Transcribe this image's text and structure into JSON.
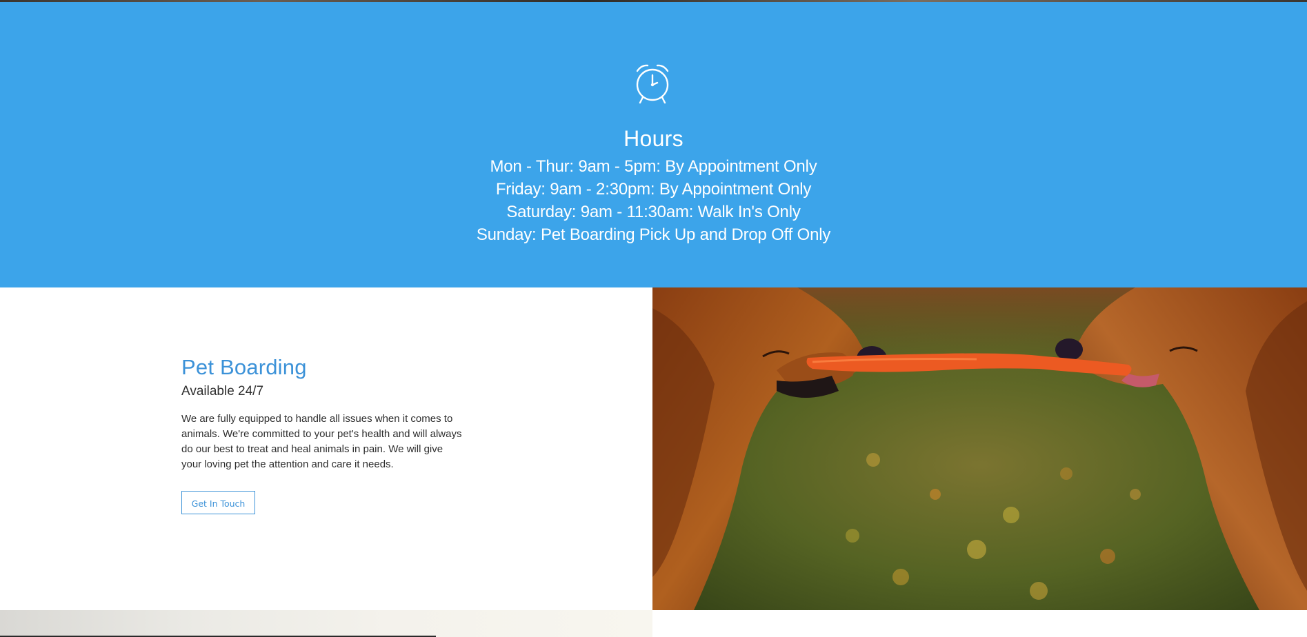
{
  "hours": {
    "icon": "alarm-clock-icon",
    "title": "Hours",
    "lines": [
      "Mon - Thur: 9am - 5pm: By Appointment Only",
      "Friday: 9am - 2:30pm: By Appointment Only",
      "Saturday: 9am - 11:30am: Walk In's Only",
      "Sunday: Pet Boarding Pick Up and Drop Off Only"
    ],
    "background_color": "#3ca4ea"
  },
  "boarding": {
    "title": "Pet Boarding",
    "subtitle": "Available 24/7",
    "description": "We are fully equipped to handle all issues when it comes to animals. We're committed to your pet's health and will always do our best to treat and heal animals in pain. We will give your loving pet the attention and care it needs.",
    "button_label": "Get In Touch",
    "accent_color": "#3c92d8"
  },
  "photo": {
    "icon": "dogs-tug-photo"
  }
}
